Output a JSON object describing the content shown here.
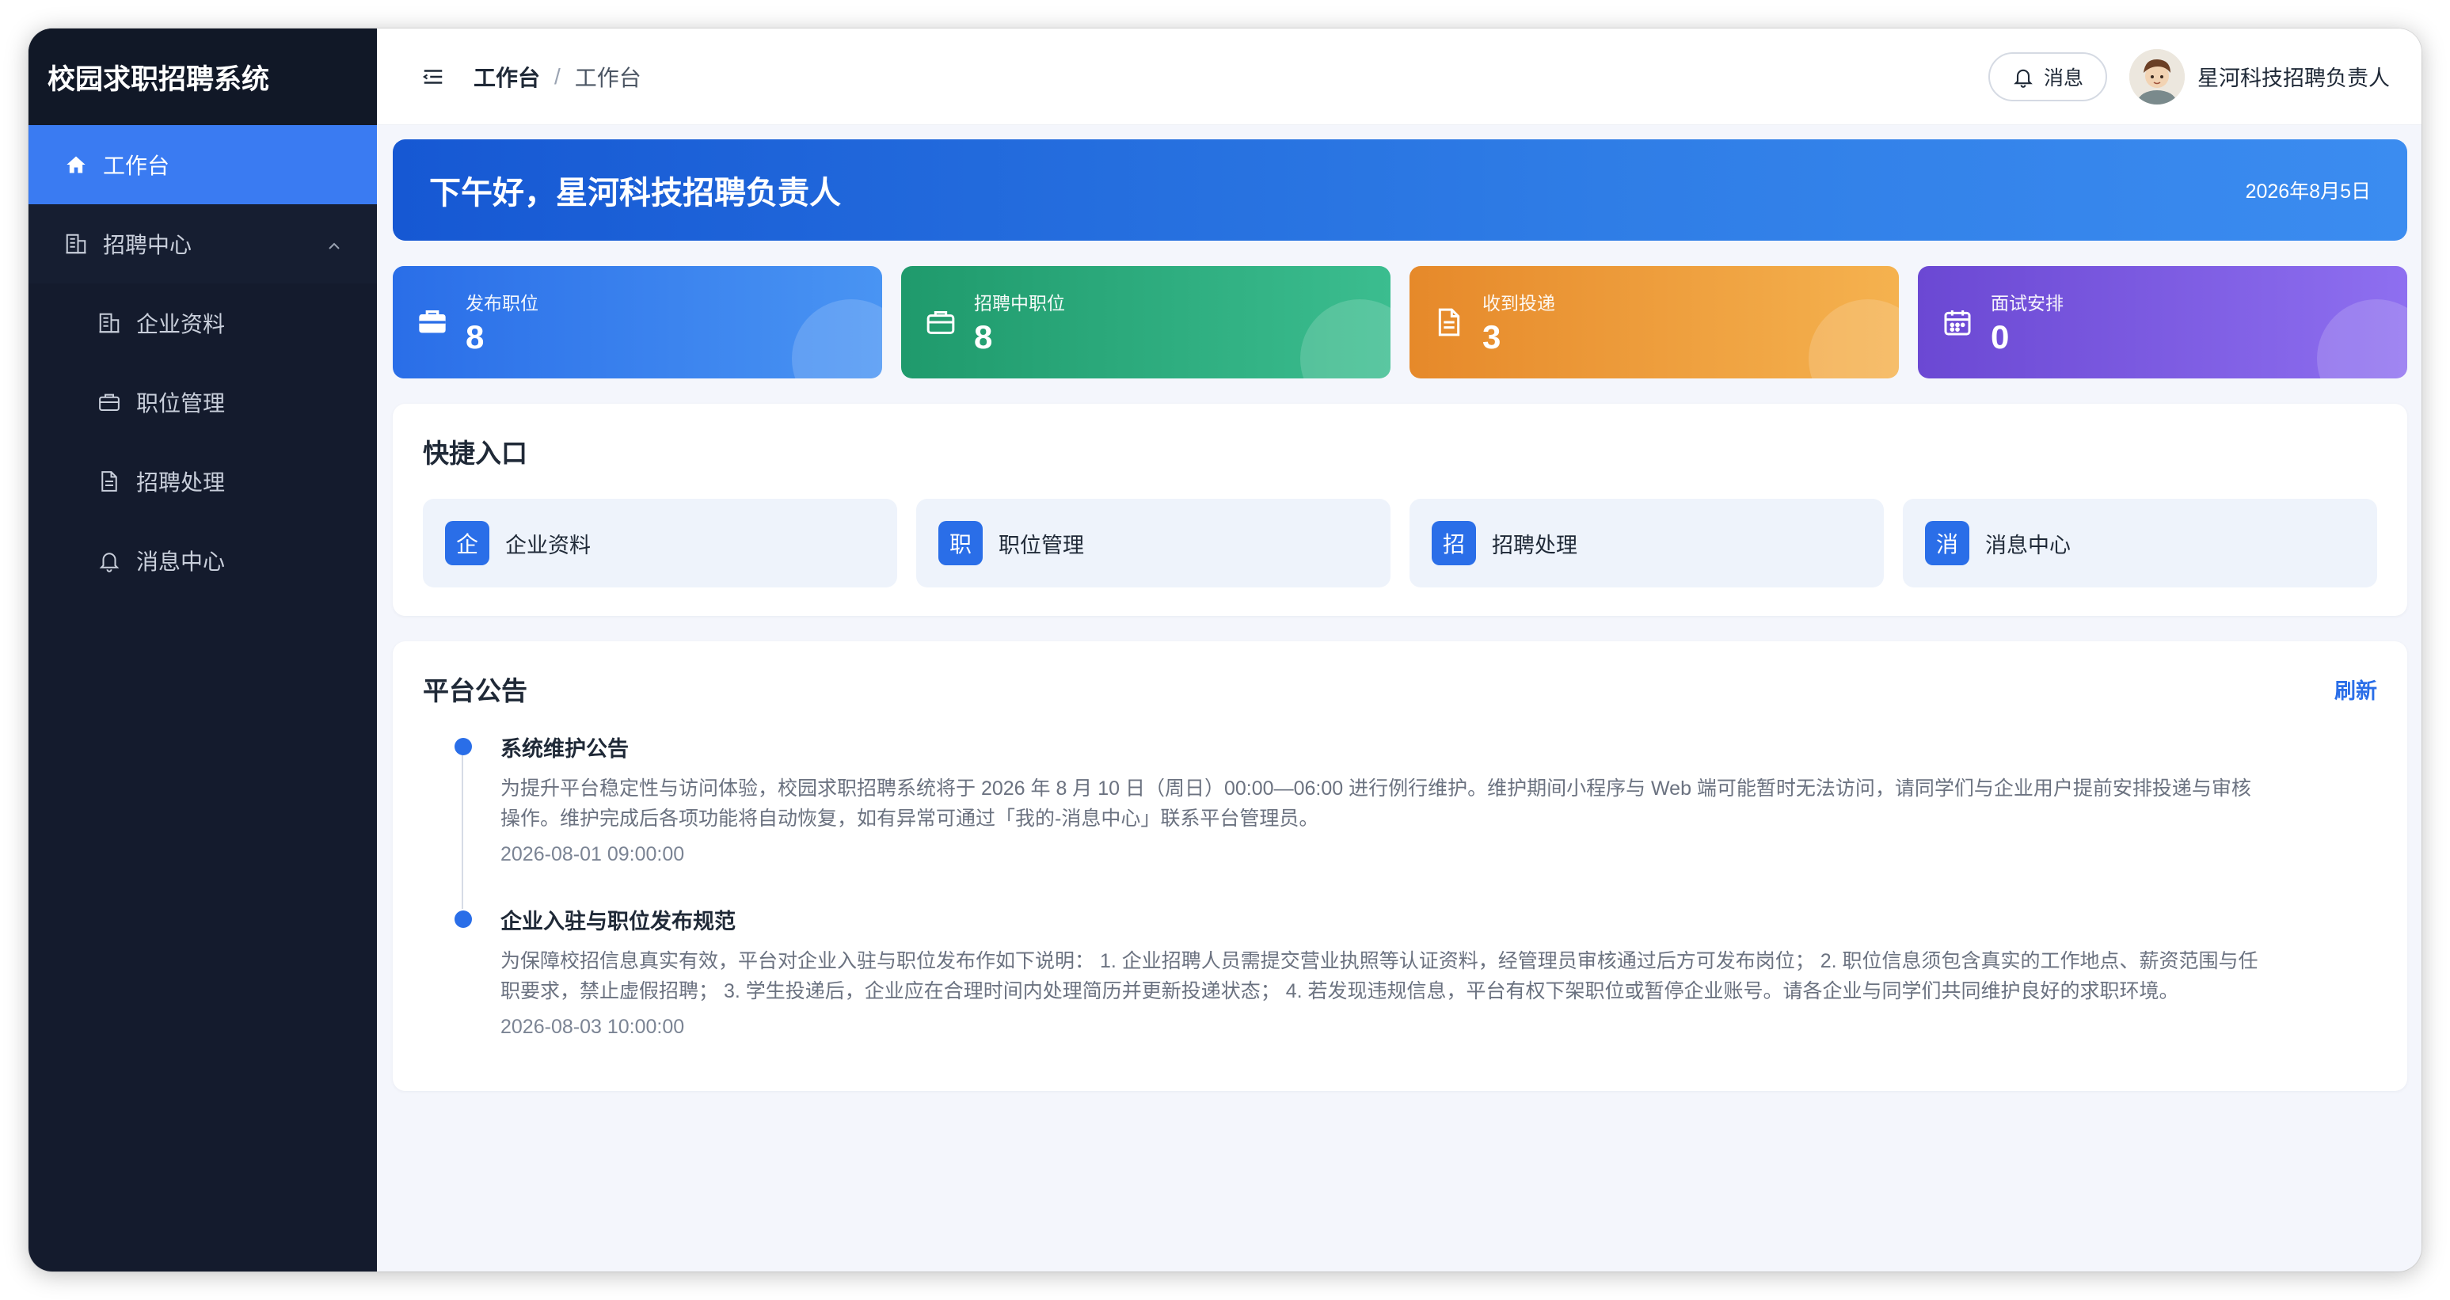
{
  "app": {
    "title": "校园求职招聘系统"
  },
  "sidebar": {
    "items": [
      {
        "label": "工作台",
        "icon": "home-icon",
        "active": true
      },
      {
        "label": "招聘中心",
        "icon": "building-icon",
        "expanded": true
      },
      {
        "label": "企业资料",
        "icon": "building-icon"
      },
      {
        "label": "职位管理",
        "icon": "briefcase-icon"
      },
      {
        "label": "招聘处理",
        "icon": "document-icon"
      },
      {
        "label": "消息中心",
        "icon": "bell-icon"
      }
    ]
  },
  "header": {
    "breadcrumb": [
      "工作台",
      "/",
      "工作台"
    ],
    "message_button": "消息",
    "user_name": "星河科技招聘负责人"
  },
  "greeting": {
    "text": "下午好，星河科技招聘负责人",
    "date": "2026年8月5日"
  },
  "stats": [
    {
      "label": "发布职位",
      "value": "8",
      "icon": "toolbox-icon",
      "color": "#2a6ee8"
    },
    {
      "label": "招聘中职位",
      "value": "8",
      "icon": "briefcase-icon",
      "color": "#1f9a6c"
    },
    {
      "label": "收到投递",
      "value": "3",
      "icon": "document-icon",
      "color": "#e6892a"
    },
    {
      "label": "面试安排",
      "value": "0",
      "icon": "calendar-icon",
      "color": "#6b48d3"
    }
  ],
  "quick": {
    "title": "快捷入口",
    "items": [
      {
        "badge": "企",
        "label": "企业资料"
      },
      {
        "badge": "职",
        "label": "职位管理"
      },
      {
        "badge": "招",
        "label": "招聘处理"
      },
      {
        "badge": "消",
        "label": "消息中心"
      }
    ]
  },
  "notices": {
    "title": "平台公告",
    "refresh": "刷新",
    "items": [
      {
        "title": "系统维护公告",
        "body_line1": "为提升平台稳定性与访问体验，校园求职招聘系统将于 2026 年 8 月 10 日（周日）00:00—06:00 进行例行维护。维护期间小程序与 Web 端可能暂时无法访问，请同学们与企业用户提前安排投递与审核",
        "body_line2": "操作。维护完成后各项功能将自动恢复，如有异常可通过「我的-消息中心」联系平台管理员。",
        "time": "2026-08-01 09:00:00"
      },
      {
        "title": "企业入驻与职位发布规范",
        "body_line1": "为保障校招信息真实有效，平台对企业入驻与职位发布作如下说明： 1. 企业招聘人员需提交营业执照等认证资料，经管理员审核通过后方可发布岗位； 2. 职位信息须包含真实的工作地点、薪资范围与任",
        "body_line2": "职要求，禁止虚假招聘； 3. 学生投递后，企业应在合理时间内处理简历并更新投递状态； 4. 若发现违规信息，平台有权下架职位或暂停企业账号。请各企业与同学们共同维护良好的求职环境。",
        "time": "2026-08-03 10:00:00"
      }
    ]
  },
  "colors": {
    "accent": "#2a6ee8",
    "sidebar": "#141b2d",
    "active": "#3a7bf2"
  }
}
